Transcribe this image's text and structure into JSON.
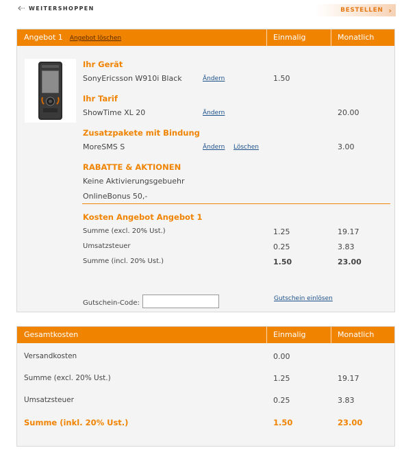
{
  "topbar": {
    "weiter_label": "WEITERSHOPPEN",
    "bestellen_label": "BESTELLEN"
  },
  "offer": {
    "header": {
      "title": "Angebot 1",
      "delete_link": "Angebot löschen",
      "col_once": "Einmalig",
      "col_monthly": "Monatlich"
    },
    "device": {
      "heading": "Ihr Gerät",
      "name": "SonyEricsson W910i Black",
      "change": "Ändern",
      "once": "1.50",
      "image": "sony-ericsson-phone"
    },
    "tariff": {
      "heading": "Ihr Tarif",
      "name": "ShowTime XL 20",
      "change": "Ändern",
      "monthly": "20.00"
    },
    "addons": {
      "heading": "Zusatzpakete mit Bindung",
      "name": "MoreSMS S",
      "change": "Ändern",
      "delete": "Löschen",
      "monthly": "3.00"
    },
    "discounts": {
      "heading": "RABATTE & AKTIONEN",
      "items": [
        "Keine Aktivierungsgebuehr",
        "OnlineBonus 50,-"
      ]
    },
    "costs": {
      "heading": "Kosten Angebot Angebot 1",
      "rows": [
        {
          "label": "Summe (excl. 20% Ust.)",
          "once": "1.25",
          "monthly": "19.17"
        },
        {
          "label": "Umsatzsteuer",
          "once": "0.25",
          "monthly": "3.83"
        },
        {
          "label": "Summe (incl. 20% Ust.)",
          "once": "1.50",
          "monthly": "23.00"
        }
      ]
    },
    "voucher": {
      "label": "Gutschein-Code:",
      "value": "",
      "redeem": "Gutschein einlösen"
    }
  },
  "total": {
    "header": {
      "title": "Gesamtkosten",
      "col_once": "Einmalig",
      "col_monthly": "Monatlich"
    },
    "rows": [
      {
        "label": "Versandkosten",
        "once": "0.00",
        "monthly": ""
      },
      {
        "label": "Summe (excl. 20% Ust.)",
        "once": "1.25",
        "monthly": "19.17"
      },
      {
        "label": "Umsatzsteuer",
        "once": "0.25",
        "monthly": "3.83"
      },
      {
        "label": "Summe (inkl. 20% Ust.)",
        "once": "1.50",
        "monthly": "23.00"
      }
    ]
  },
  "colors": {
    "accent": "#f08300",
    "link": "#1a4f8a",
    "panel_bg": "#f4f4f4"
  }
}
